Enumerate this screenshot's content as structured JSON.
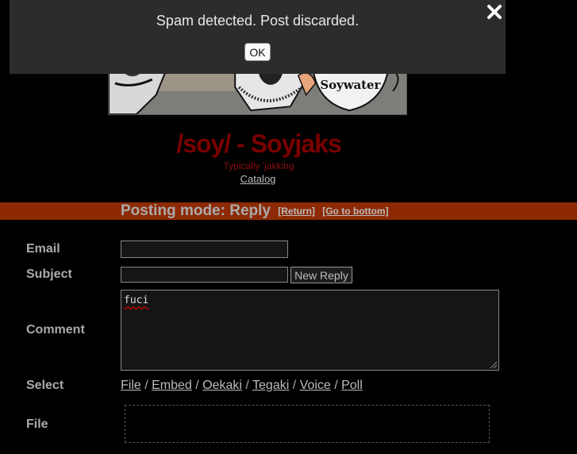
{
  "modal": {
    "message": "Spam detected. Post discarded.",
    "ok_label": "OK",
    "close_icon": "close-x-icon"
  },
  "banner": {
    "cup_text": "Soywater"
  },
  "board": {
    "title": "/soy/ - Soyjaks",
    "subtitle": "Typically 'jakking",
    "catalog_label": "Catalog"
  },
  "posting_mode": {
    "label": "Posting mode: Reply",
    "return_label": "[Return]",
    "bottom_label": "[Go to bottom]"
  },
  "form": {
    "email_label": "Email",
    "email_value": "",
    "subject_label": "Subject",
    "subject_value": "",
    "new_reply_label": "New Reply",
    "comment_label": "Comment",
    "comment_value": "fuci",
    "select_label": "Select",
    "select_options": [
      "File",
      "Embed",
      "Oekaki",
      "Tegaki",
      "Voice",
      "Poll"
    ],
    "file_label": "File"
  },
  "colors": {
    "background": "#000000",
    "title_red": "#7a0000",
    "bar_orange": "#8d2a05",
    "modal_bg": "#2c2c2c"
  }
}
